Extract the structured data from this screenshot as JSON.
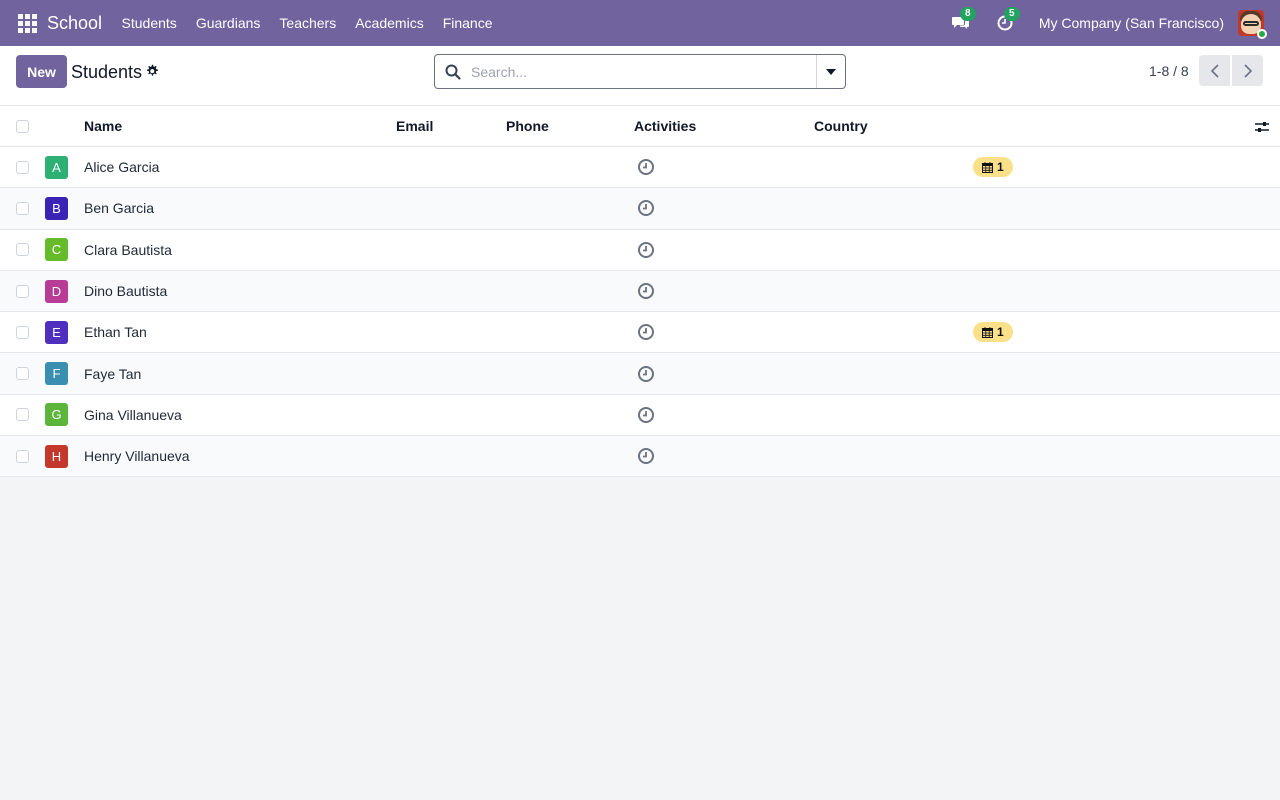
{
  "navbar": {
    "brand": "School",
    "menu": [
      "Students",
      "Guardians",
      "Teachers",
      "Academics",
      "Finance"
    ],
    "messages_count": "8",
    "activities_count": "5",
    "company": "My Company (San Francisco)",
    "color": "#71639e"
  },
  "control_panel": {
    "new_label": "New",
    "title": "Students",
    "search_placeholder": "Search...",
    "pager": "1-8 / 8"
  },
  "list": {
    "columns": {
      "name": "Name",
      "email": "Email",
      "phone": "Phone",
      "activities": "Activities",
      "country": "Country"
    },
    "rows": [
      {
        "initial": "A",
        "name": "Alice Garcia",
        "color": "#2eaf73",
        "tag": "1"
      },
      {
        "initial": "B",
        "name": "Ben Garcia",
        "color": "#3b24b5",
        "tag": null
      },
      {
        "initial": "C",
        "name": "Clara Bautista",
        "color": "#66bb2b",
        "tag": null
      },
      {
        "initial": "D",
        "name": "Dino Bautista",
        "color": "#b83c95",
        "tag": null
      },
      {
        "initial": "E",
        "name": "Ethan Tan",
        "color": "#4f2fbd",
        "tag": "1"
      },
      {
        "initial": "F",
        "name": "Faye Tan",
        "color": "#3a8fb0",
        "tag": null
      },
      {
        "initial": "G",
        "name": "Gina Villanueva",
        "color": "#5cb53a",
        "tag": null
      },
      {
        "initial": "H",
        "name": "Henry Villanueva",
        "color": "#c4372b",
        "tag": null
      }
    ]
  }
}
